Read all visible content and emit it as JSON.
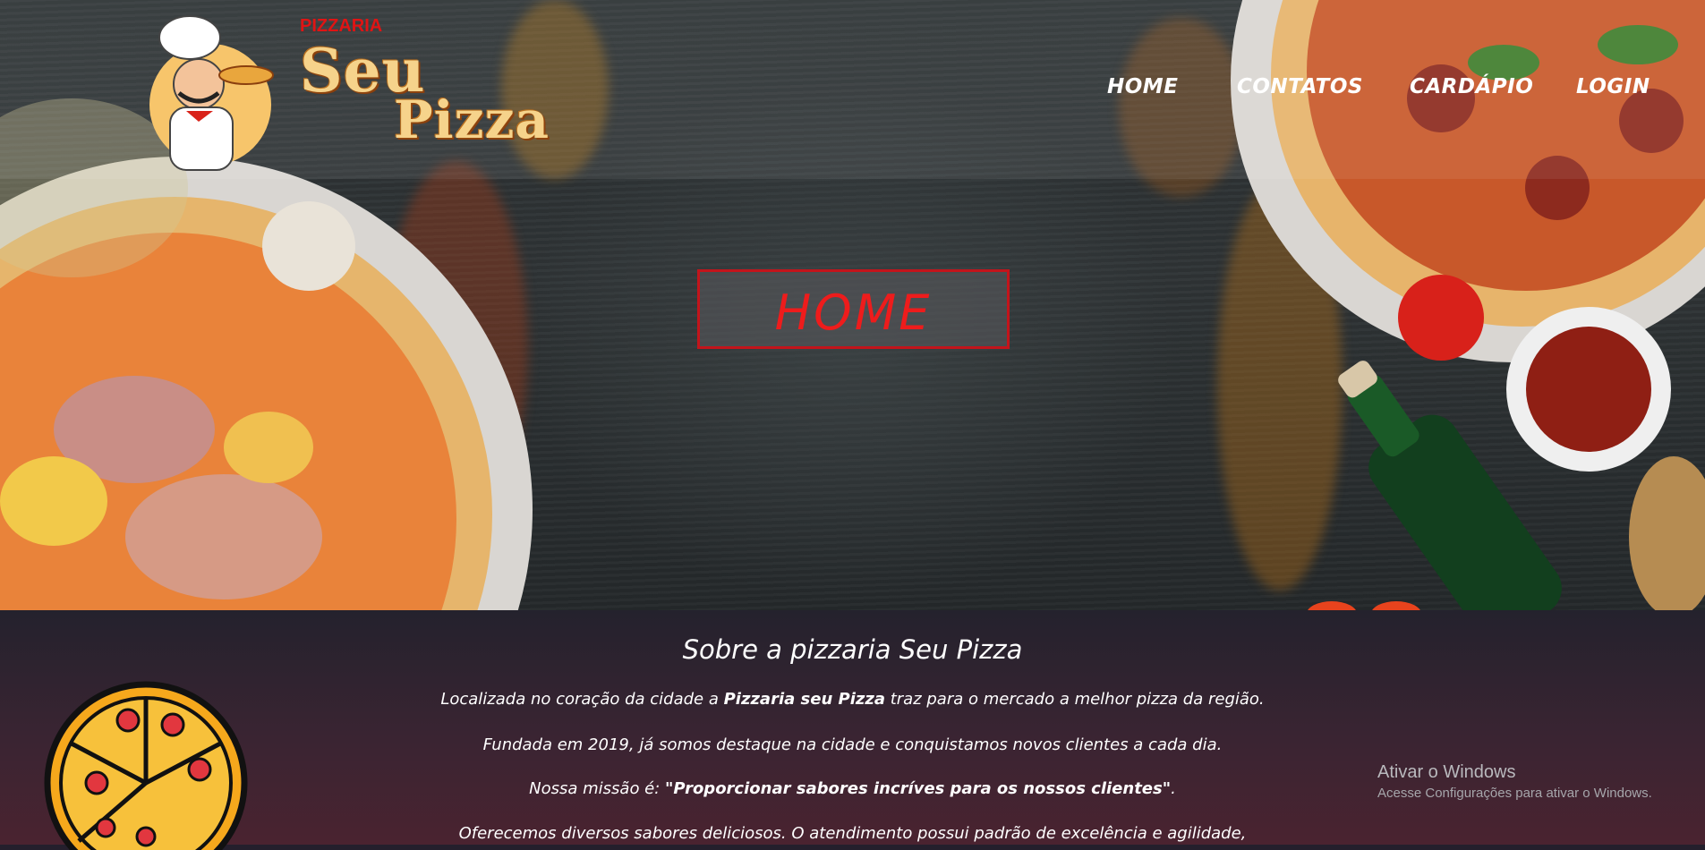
{
  "brand": {
    "small_label": "PIZZARIA",
    "name_line1": "Seu",
    "name_line2": "Pizza"
  },
  "nav": {
    "items": [
      {
        "label": "HOME"
      },
      {
        "label": "CONTATOS"
      },
      {
        "label": "CARDÁPIO"
      },
      {
        "label": "LOGIN"
      }
    ]
  },
  "hero": {
    "title": "HOME"
  },
  "about": {
    "title": "Sobre a pizzaria Seu Pizza",
    "p1_before": "Localizada no coração da cidade a ",
    "p1_bold": "Pizzaria seu Pizza",
    "p1_after": " traz para o mercado a melhor pizza da região.",
    "p2": "Fundada em 2019, já somos destaque na cidade e conquistamos novos clientes a cada dia.",
    "p3_before": "Nossa missão é: ",
    "p3_bold": "\"Proporcionar sabores incríves para os nossos clientes\"",
    "p3_after": ".",
    "p4": "Oferecemos diversos sabores deliciosos. O atendimento possui padrão de excelência e agilidade,"
  },
  "windows_watermark": {
    "title": "Ativar o Windows",
    "subtitle": "Acesse Configurações para ativar o Windows."
  },
  "colors": {
    "accent_red": "#e01414",
    "hero_border": "#c3141b",
    "about_bg_top": "#24222d",
    "about_bg_bottom": "#4a2330"
  }
}
